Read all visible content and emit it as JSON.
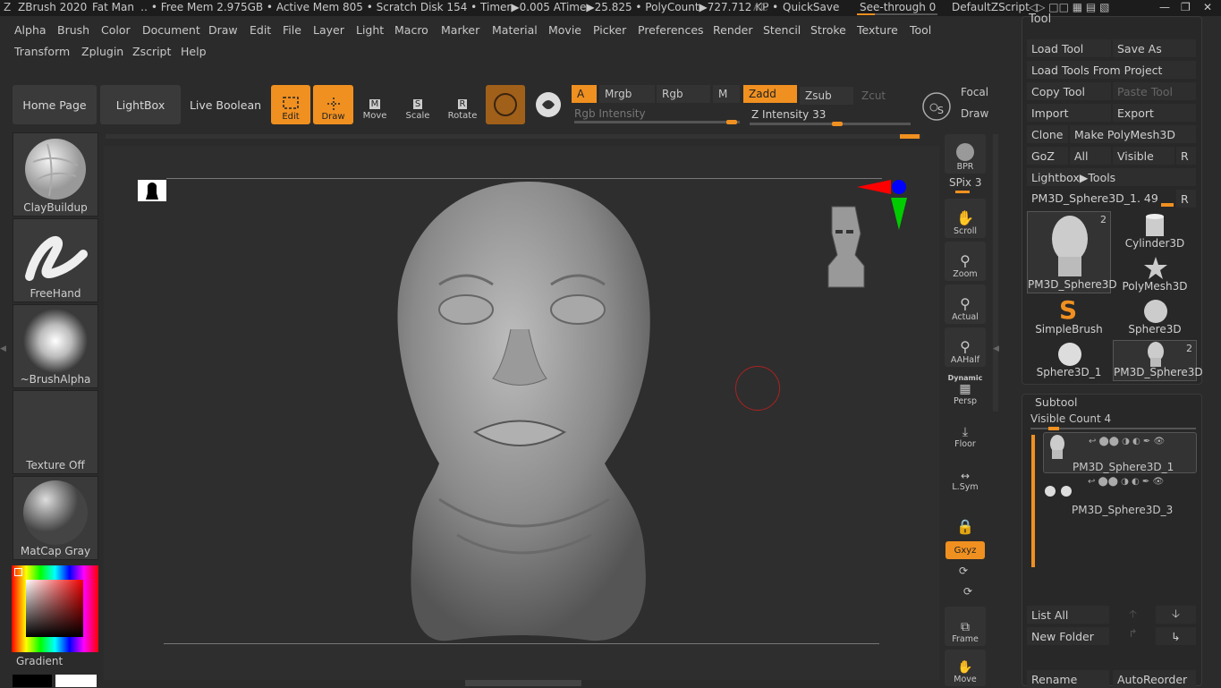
{
  "titlebar": {
    "app": "ZBrush 2020",
    "doc": "Fat Man",
    "stats": "‥ • Free Mem 2.975GB • Active Mem 805 • Scratch Disk 154 •   Timer▶0.005 ATime▶25.825 • PolyCount▶727.712 KP  •",
    "ac": "AC",
    "quicksave": "QuickSave",
    "seethrough": "See-through   0",
    "script": "DefaultZScript"
  },
  "menus": [
    "Alpha",
    "Brush",
    "Color",
    "Document",
    "Draw",
    "Edit",
    "File",
    "Layer",
    "Light",
    "Macro",
    "Marker",
    "Material",
    "Movie",
    "Picker",
    "Preferences",
    "Render",
    "Stencil",
    "Stroke",
    "Texture",
    "Tool"
  ],
  "menus2": [
    "Transform",
    "Zplugin",
    "Zscript",
    "Help"
  ],
  "shelf": {
    "home": "Home Page",
    "lightbox": "LightBox",
    "liveboolean": "Live Boolean",
    "edit": "Edit",
    "draw": "Draw",
    "move": "Move",
    "scale": "Scale",
    "rotate": "Rotate",
    "a": "A",
    "mrgb": "Mrgb",
    "rgb": "Rgb",
    "m": "M",
    "zadd": "Zadd",
    "zsub": "Zsub",
    "zcut": "Zcut",
    "rgb_intensity": "Rgb Intensity",
    "z_intensity": "Z Intensity 33",
    "focal": "Focal",
    "drawsize": "Draw",
    "s": "S"
  },
  "left": {
    "brush": "ClayBuildup",
    "stroke": "FreeHand",
    "alpha": "~BrushAlpha",
    "texture": "Texture Off",
    "material": "MatCap Gray",
    "gradient": "Gradient"
  },
  "right_shelf": {
    "bpr": "BPR",
    "spix": "SPix 3",
    "scroll": "Scroll",
    "zoom": "Zoom",
    "actual": "Actual",
    "aahalf": "AAHalf",
    "dynamic": "Dynamic",
    "persp": "Persp",
    "floor": "Floor",
    "lsym": "L.Sym",
    "xyz": "Gxyz",
    "frame": "Frame",
    "move": "Move"
  },
  "toolpanel": {
    "title": "Tool",
    "load_tool": "Load Tool",
    "save_as": "Save As",
    "load_from_project": "Load Tools From Project",
    "copy_tool": "Copy Tool",
    "paste_tool": "Paste Tool",
    "import": "Import",
    "export": "Export",
    "clone": "Clone",
    "make_polymesh": "Make PolyMesh3D",
    "goz": "GoZ",
    "all": "All",
    "visible": "Visible",
    "r": "R",
    "lightbox_tools": "Lightbox▶Tools",
    "current_tool": "PM3D_Sphere3D_1. 49",
    "tools": [
      {
        "name": "PM3D_Sphere3D",
        "badge": "2"
      },
      {
        "name": "Cylinder3D",
        "badge": ""
      },
      {
        "name": "PolyMesh3D",
        "badge": ""
      },
      {
        "name": "SimpleBrush",
        "badge": ""
      },
      {
        "name": "Sphere3D",
        "badge": ""
      },
      {
        "name": "Sphere3D_1",
        "badge": ""
      },
      {
        "name": "PM3D_Sphere3D",
        "badge": "2"
      }
    ]
  },
  "subtool": {
    "title": "Subtool",
    "visible_count": "Visible Count 4",
    "items": [
      "PM3D_Sphere3D_1",
      "PM3D_Sphere3D_3"
    ],
    "list_all": "List All",
    "new_folder": "New Folder",
    "rename": "Rename",
    "autoreorder": "AutoReorder"
  },
  "colors": {
    "accent": "#f09020",
    "bg": "#2b2b2b",
    "panel": "#3a3a3a"
  }
}
